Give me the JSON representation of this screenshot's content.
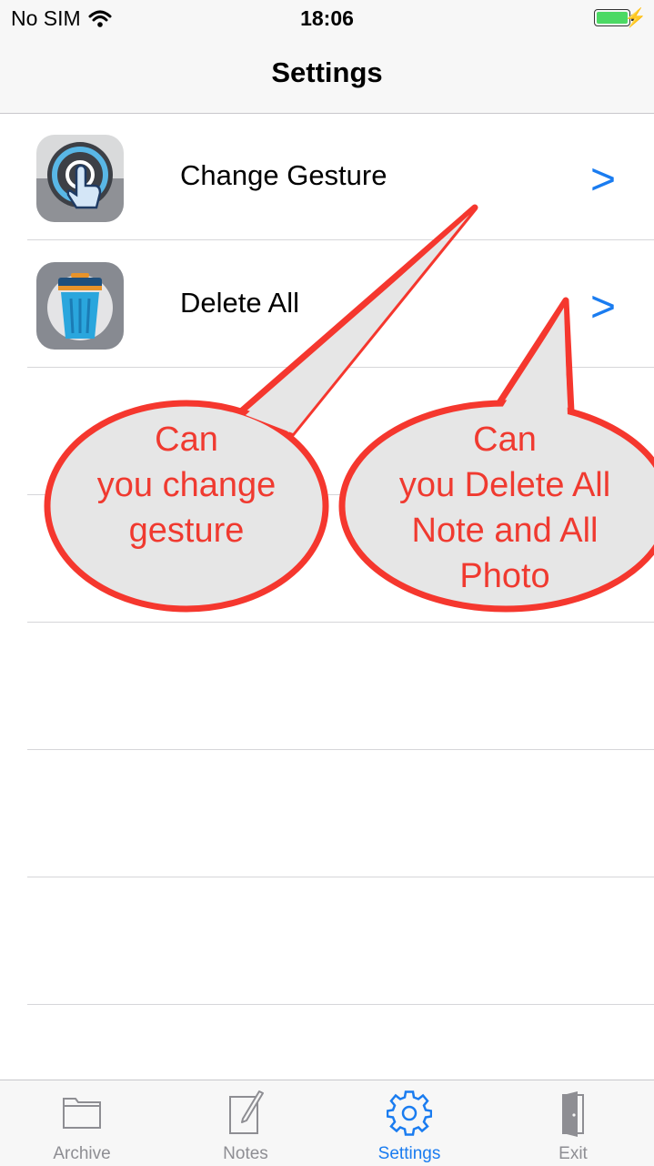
{
  "status_bar": {
    "carrier": "No SIM",
    "time": "18:06",
    "battery_color": "#4cd964",
    "icons": [
      "wifi-icon",
      "battery-icon",
      "charging-bolt-icon"
    ]
  },
  "nav": {
    "title": "Settings"
  },
  "rows": [
    {
      "label": "Change Gesture",
      "icon": "touch-gesture-icon",
      "chevron": ">"
    },
    {
      "label": "Delete All",
      "icon": "trash-can-icon",
      "chevron": ">"
    }
  ],
  "callouts": [
    {
      "lines": [
        "Can",
        "you change",
        "gesture"
      ]
    },
    {
      "lines": [
        "Can",
        "you Delete All",
        "Note and All",
        "Photo"
      ]
    }
  ],
  "tabs": [
    {
      "label": "Archive",
      "icon": "folder-icon",
      "active": false
    },
    {
      "label": "Notes",
      "icon": "note-pencil-icon",
      "active": false
    },
    {
      "label": "Settings",
      "icon": "gear-icon",
      "active": true
    },
    {
      "label": "Exit",
      "icon": "door-icon",
      "active": false
    }
  ],
  "colors": {
    "accent": "#1a7cf0",
    "callout_text": "#f03a30",
    "callout_fill": "#e6e6e6",
    "callout_stroke": "#f5372e"
  }
}
